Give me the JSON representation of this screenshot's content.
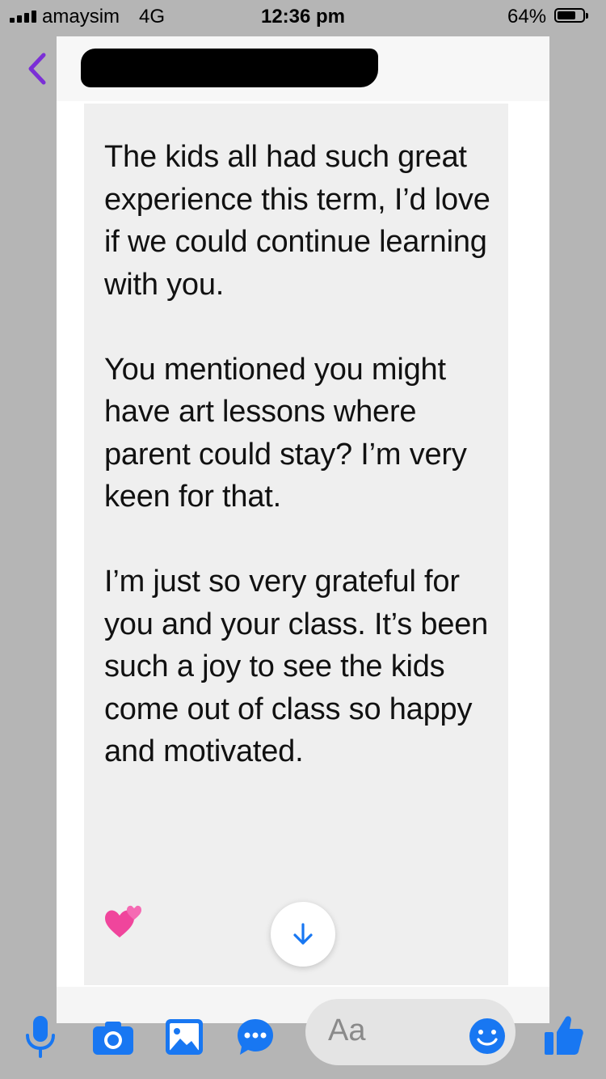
{
  "status_bar": {
    "carrier": "amaysim",
    "network": "4G",
    "time": "12:36 pm",
    "battery": "64%",
    "battery_level": 0.64
  },
  "header": {
    "contact_name": ""
  },
  "message": {
    "paragraphs": [
      "The kids all had such great experience this term, I’d love if we could continue learning with you.",
      "You mentioned you might have art lessons where parent could stay? I’m very keen for that.",
      "I’m just so very grateful for you and your class. It’s been such a joy to see the kids come out of class so happy and motivated."
    ],
    "emoji": "💕"
  },
  "composer": {
    "placeholder": "Aa"
  },
  "colors": {
    "accent": "#1877f2",
    "back": "#7b2fd6",
    "bubble": "#efefef",
    "dimmed_background": "#b5b5b5"
  },
  "icons": [
    "back-chevron-icon",
    "arrow-down-icon",
    "microphone-icon",
    "camera-icon",
    "image-icon",
    "chat-more-icon",
    "smile-icon",
    "thumbs-up-icon"
  ]
}
